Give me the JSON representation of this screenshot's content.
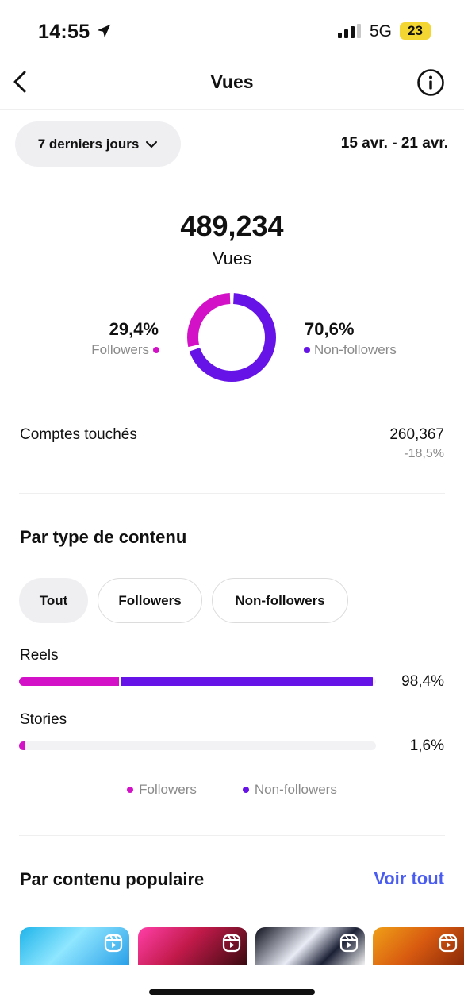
{
  "status_bar": {
    "time": "14:55",
    "network": "5G",
    "battery": "23"
  },
  "nav": {
    "title": "Vues"
  },
  "range": {
    "selector_label": "7 derniers jours",
    "dates": "15 avr. - 21 avr."
  },
  "summary": {
    "total": "489,234",
    "label": "Vues",
    "followers_pct": "29,4%",
    "followers_label": "Followers",
    "nonfollowers_pct": "70,6%",
    "nonfollowers_label": "Non-followers",
    "followers_fraction": 0.294,
    "nonfollowers_fraction": 0.706
  },
  "reach": {
    "label": "Comptes touchés",
    "value": "260,367",
    "change": "-18,5%"
  },
  "content_type": {
    "title": "Par type de contenu",
    "filters": [
      "Tout",
      "Followers",
      "Non-followers"
    ],
    "selected_filter": "Tout",
    "rows": [
      {
        "label": "Reels",
        "pct": "98,4%",
        "total_fraction": 0.984,
        "followers_fraction": 0.28,
        "nonfollowers_fraction": 0.704
      },
      {
        "label": "Stories",
        "pct": "1,6%",
        "total_fraction": 0.016,
        "followers_fraction": 0.016,
        "nonfollowers_fraction": 0.0
      }
    ],
    "legend": [
      "Followers",
      "Non-followers"
    ]
  },
  "popular": {
    "title": "Par contenu populaire",
    "see_all": "Voir tout"
  },
  "colors": {
    "followers": "#d312c8",
    "nonfollowers": "#6513e6",
    "link": "#4a5df0"
  },
  "icons": [
    "location-arrow-icon",
    "signal-icon",
    "back-chevron-icon",
    "info-icon",
    "chevron-down-icon",
    "reel-icon"
  ]
}
